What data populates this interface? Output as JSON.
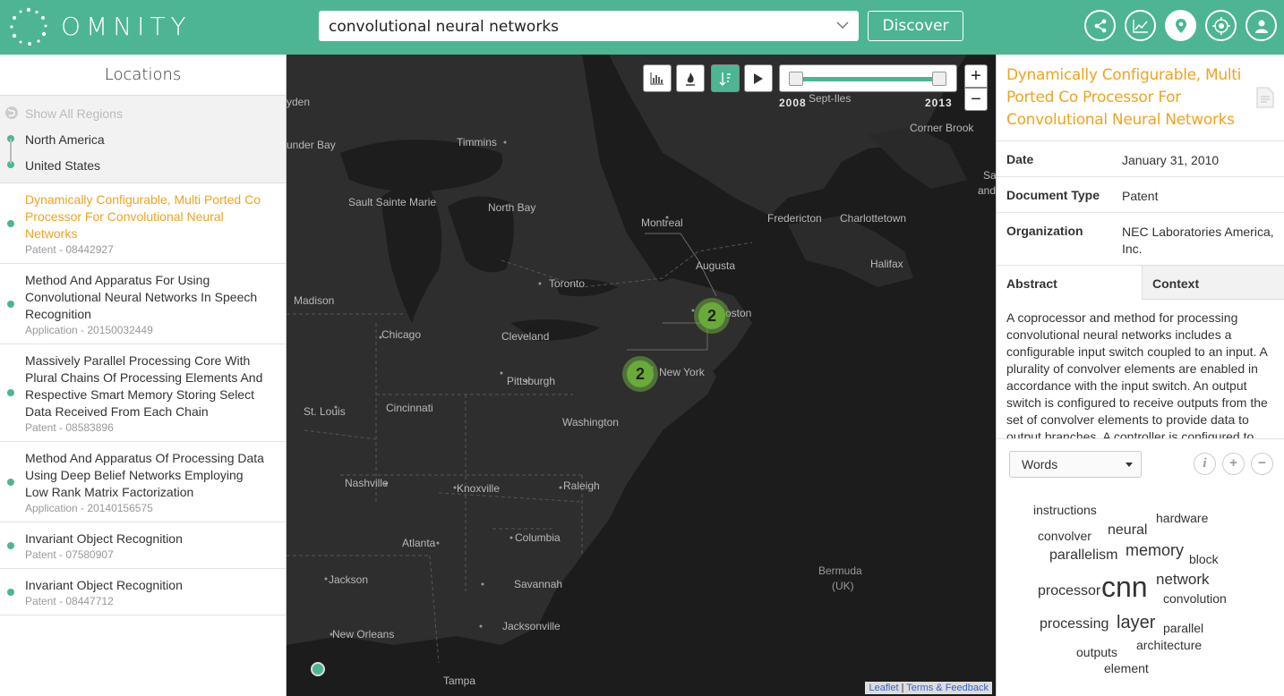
{
  "app": {
    "brand": "OMNITY",
    "accent": "#4db593",
    "highlight": "#f0a31e"
  },
  "search": {
    "value": "convolutional neural networks",
    "discover_label": "Discover"
  },
  "top_icons": [
    "share-icon",
    "chart-icon",
    "location-pin-icon",
    "target-icon",
    "user-icon"
  ],
  "left_panel": {
    "header": "Locations",
    "show_all": "Show All Regions",
    "regions": [
      "North America",
      "United States"
    ],
    "results": [
      {
        "title": "Dynamically Configurable, Multi Ported Co Processor For Convolutional Neural Networks",
        "meta": "Patent - 08442927",
        "selected": true
      },
      {
        "title": "Method And Apparatus For Using Convolutional Neural Networks In Speech Recognition",
        "meta": "Application - 20150032449"
      },
      {
        "title": "Massively Parallel Processing Core With Plural Chains Of Processing Elements And Respective Smart Memory Storing Select Data Received From Each Chain",
        "meta": "Patent - 08583896"
      },
      {
        "title": "Method And Apparatus Of Processing Data Using Deep Belief Networks Employing Low Rank Matrix Factorization",
        "meta": "Application - 20140156575"
      },
      {
        "title": "Invariant Object Recognition",
        "meta": "Patent - 07580907"
      },
      {
        "title": "Invariant Object Recognition",
        "meta": "Patent - 08447712"
      }
    ]
  },
  "map": {
    "year_start": "2008",
    "year_end": "2013",
    "zoom_in": "+",
    "zoom_out": "−",
    "clusters": [
      "2",
      "2"
    ],
    "labels": [
      "Sept-Iles",
      "Corner Brook",
      "Timmins",
      "Sault Sainte Marie",
      "North Bay",
      "Montreal",
      "Fredericton",
      "Charlottetown",
      "Augusta",
      "Halifax",
      "Madison",
      "Toronto",
      "Chicago",
      "Cleveland",
      "Boston",
      "New York",
      "Pittsburgh",
      "Washington",
      "Cincinnati",
      "St. Louis",
      "Nashville",
      "Knoxville",
      "Raleigh",
      "Atlanta",
      "Columbia",
      "Jackson",
      "Savannah",
      "Jacksonville",
      "New Orleans",
      "Tampa",
      "Bermuda",
      "(UK)",
      "yden",
      "under Bay",
      "Sa",
      "and"
    ],
    "attribution_leaflet": "Leaflet",
    "attribution_sep": " | ",
    "attribution_terms": "Terms & Feedback"
  },
  "detail": {
    "title": "Dynamically Configurable, Multi Ported Co Processor For Convolutional Neural Networks",
    "fields": [
      {
        "label": "Date",
        "value": "January 31, 2010"
      },
      {
        "label": "Document Type",
        "value": "Patent"
      },
      {
        "label": "Organization",
        "value": "NEC Laboratories America, Inc."
      }
    ],
    "tabs": [
      "Abstract",
      "Context"
    ],
    "abstract": "A coprocessor and method for processing convolutional neural networks includes a configurable input switch coupled to an input. A plurality of convolver elements are enabled in accordance with the input switch. An output switch is configured to receive outputs from the set of convolver elements to provide data to output branches. A controller is configured to",
    "word_mode": "Words",
    "info_btn": "i",
    "plus_btn": "+",
    "minus_btn": "−",
    "words": [
      "instructions",
      "hardware",
      "convolver",
      "neural",
      "memory",
      "parallelism",
      "block",
      "network",
      "processor",
      "cnn",
      "convolution",
      "processing",
      "layer",
      "parallel",
      "architecture",
      "outputs",
      "element"
    ]
  }
}
